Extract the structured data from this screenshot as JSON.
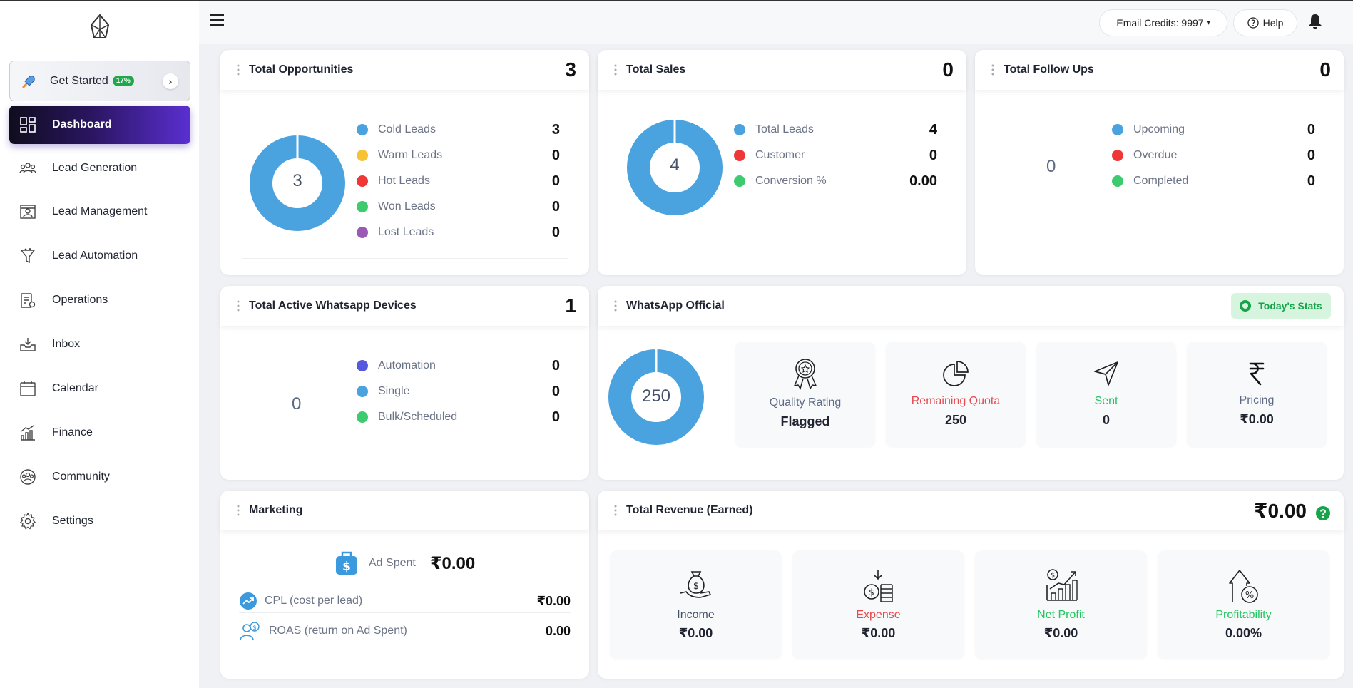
{
  "sidebar": {
    "get_started": {
      "label": "Get Started",
      "badge": "17%"
    },
    "items": [
      {
        "label": "Dashboard"
      },
      {
        "label": "Lead Generation"
      },
      {
        "label": "Lead Management"
      },
      {
        "label": "Lead Automation"
      },
      {
        "label": "Operations"
      },
      {
        "label": "Inbox"
      },
      {
        "label": "Calendar"
      },
      {
        "label": "Finance"
      },
      {
        "label": "Community"
      },
      {
        "label": "Settings"
      }
    ]
  },
  "topbar": {
    "credits": "Email Credits: 9997",
    "help": "Help"
  },
  "opportunities": {
    "title": "Total Opportunities",
    "value": "3",
    "donut": "3",
    "legend": [
      {
        "label": "Cold Leads",
        "value": "3",
        "color": "#4aa3df"
      },
      {
        "label": "Warm Leads",
        "value": "0",
        "color": "#f7c234"
      },
      {
        "label": "Hot Leads",
        "value": "0",
        "color": "#f03737"
      },
      {
        "label": "Won Leads",
        "value": "0",
        "color": "#3ecb6f"
      },
      {
        "label": "Lost Leads",
        "value": "0",
        "color": "#9b59b6"
      }
    ]
  },
  "sales": {
    "title": "Total Sales",
    "value": "0",
    "donut": "4",
    "legend": [
      {
        "label": "Total Leads",
        "value": "4",
        "color": "#4aa3df"
      },
      {
        "label": "Customer",
        "value": "0",
        "color": "#f03737"
      },
      {
        "label": "Conversion %",
        "value": "0.00",
        "color": "#3ecb6f"
      }
    ]
  },
  "followups": {
    "title": "Total Follow Ups",
    "value": "0",
    "center": "0",
    "legend": [
      {
        "label": "Upcoming",
        "value": "0",
        "color": "#4aa3df"
      },
      {
        "label": "Overdue",
        "value": "0",
        "color": "#f03737"
      },
      {
        "label": "Completed",
        "value": "0",
        "color": "#3ecb6f"
      }
    ]
  },
  "whatsapp_devices": {
    "title": "Total Active Whatsapp Devices",
    "value": "1",
    "center": "0",
    "legend": [
      {
        "label": "Automation",
        "value": "0",
        "color": "#5658dd"
      },
      {
        "label": "Single",
        "value": "0",
        "color": "#4aa3df"
      },
      {
        "label": "Bulk/Scheduled",
        "value": "0",
        "color": "#3ecb6f"
      }
    ]
  },
  "whatsapp_official": {
    "title": "WhatsApp Official",
    "today_btn": "Today's Stats",
    "donut": "250",
    "tiles": [
      {
        "label": "Quality Rating",
        "value": "Flagged",
        "color": "#5d6a84",
        "icon": "award-icon"
      },
      {
        "label": "Remaining Quota",
        "value": "250",
        "color": "#e5484d",
        "icon": "pie-chart-icon"
      },
      {
        "label": "Sent",
        "value": "0",
        "color": "#22c55e",
        "icon": "send-icon"
      },
      {
        "label": "Pricing",
        "value": "₹0.00",
        "color": "#5d6a84",
        "icon": "rupee-icon"
      }
    ]
  },
  "marketing": {
    "title": "Marketing",
    "ad_spent_label": "Ad Spent",
    "ad_spent_value": "₹0.00",
    "cpl_label": "CPL (cost per lead)",
    "cpl_value": "₹0.00",
    "roas_label": "ROAS (return on Ad Spent)",
    "roas_value": "0.00"
  },
  "revenue": {
    "title": "Total Revenue (Earned)",
    "value": "₹0.00",
    "tiles": [
      {
        "label": "Income",
        "value": "₹0.00",
        "color": "#465269",
        "icon": "money-bag-icon"
      },
      {
        "label": "Expense",
        "value": "₹0.00",
        "color": "#e5484d",
        "icon": "coins-icon"
      },
      {
        "label": "Net Profit",
        "value": "₹0.00",
        "color": "#22c55e",
        "icon": "growth-chart-icon"
      },
      {
        "label": "Profitability",
        "value": "0.00%",
        "color": "#22c55e",
        "icon": "percent-arrow-icon"
      }
    ]
  }
}
